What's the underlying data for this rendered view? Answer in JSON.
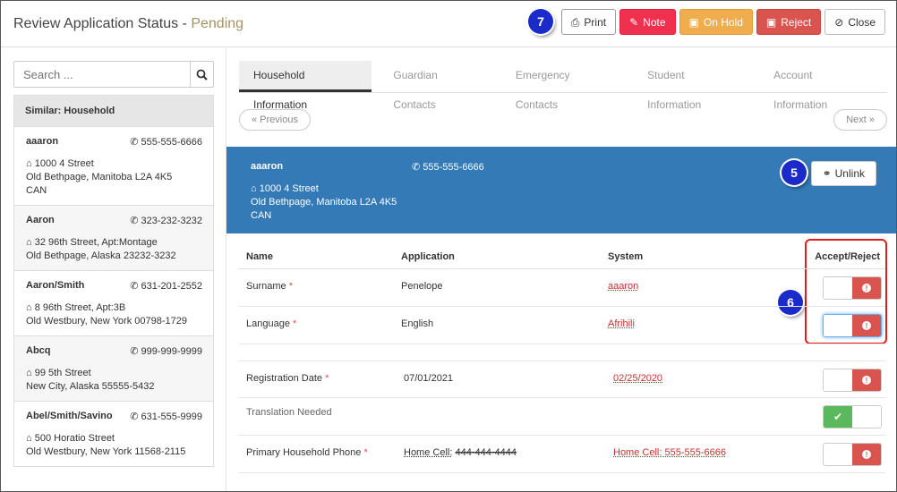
{
  "header": {
    "title": "Review Application Status -",
    "status": "Pending"
  },
  "toolbar": {
    "print": "Print",
    "note": "Note",
    "hold": "On Hold",
    "reject": "Reject",
    "close": "Close"
  },
  "callouts": {
    "seven": "7",
    "five": "5",
    "six": "6"
  },
  "search": {
    "placeholder": "Search ..."
  },
  "similar": {
    "heading": "Similar: Household",
    "items": [
      {
        "name": "aaaron",
        "phone": "555-555-6666",
        "addr1": "1000 4 Street",
        "addr2": "Old Bethpage, Manitoba L2A 4K5",
        "addr3": "CAN"
      },
      {
        "name": "Aaron",
        "phone": "323-232-3232",
        "addr1": "32 96th Street, Apt:Montage",
        "addr2": "Old Bethpage, Alaska 23232-3232",
        "addr3": ""
      },
      {
        "name": "Aaron/Smith",
        "phone": "631-201-2552",
        "addr1": "8 96th Street, Apt:3B",
        "addr2": "Old Westbury, New York 00798-1729",
        "addr3": ""
      },
      {
        "name": "Abcq",
        "phone": "999-999-9999",
        "addr1": "99 5th Street",
        "addr2": "New City, Alaska 55555-5432",
        "addr3": ""
      },
      {
        "name": "Abel/Smith/Savino",
        "phone": "631-555-9999",
        "addr1": "500 Horatio Street",
        "addr2": "Old Westbury, New York 11568-2115",
        "addr3": ""
      }
    ]
  },
  "tabs": [
    "Household Information",
    "Guardian Contacts",
    "Emergency Contacts",
    "Student Information",
    "Account Information"
  ],
  "pager": {
    "prev": "« Previous",
    "next": "Next »"
  },
  "household": {
    "name": "aaaron",
    "phone": "555-555-6666",
    "addr1": "1000 4 Street",
    "addr2": "Old Bethpage, Manitoba L2A 4K5",
    "addr3": "CAN",
    "unlink": "Unlink"
  },
  "table": {
    "headers": {
      "name": "Name",
      "application": "Application",
      "system": "System",
      "action": "Accept/Reject"
    },
    "rows": [
      {
        "name": "Surname",
        "app": "Penelope",
        "sys": "aaaron"
      },
      {
        "name": "Language",
        "app": "English",
        "sys": "Afrihili"
      },
      {
        "name": "Registration Date",
        "app": "07/01/2021",
        "sys": "02/25/2020"
      },
      {
        "name": "Translation Needed",
        "app": "",
        "sys": ""
      },
      {
        "name": "Primary Household Phone",
        "app_label": "Home Cell:",
        "app_value": "444-444-4444",
        "sys": "Home Cell: 555-555-6666"
      }
    ],
    "required_mark": "*"
  },
  "colors": {
    "accent": "#337ab7",
    "reject": "#d9534f",
    "accept": "#5cb85c",
    "hold": "#f0ad4e",
    "note": "#f0304f",
    "callout": "#1a2bc9"
  }
}
